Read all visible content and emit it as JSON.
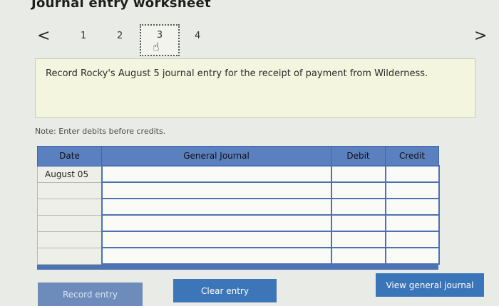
{
  "page": {
    "title": "Journal entry worksheet"
  },
  "nav": {
    "prev": "<",
    "next": ">",
    "tabs": [
      {
        "label": "1"
      },
      {
        "label": "2"
      },
      {
        "label": "3"
      },
      {
        "label": "4"
      }
    ]
  },
  "question": {
    "text": "Record Rocky's August 5 journal entry for the receipt of payment from Wilderness."
  },
  "note": {
    "text": "Note: Enter debits before credits."
  },
  "journal": {
    "headers": {
      "date": "Date",
      "account": "General Journal",
      "debit": "Debit",
      "credit": "Credit"
    },
    "rows": [
      {
        "date": "August 05",
        "account": "",
        "debit": "",
        "credit": ""
      },
      {
        "date": "",
        "account": "",
        "debit": "",
        "credit": ""
      },
      {
        "date": "",
        "account": "",
        "debit": "",
        "credit": ""
      },
      {
        "date": "",
        "account": "",
        "debit": "",
        "credit": ""
      },
      {
        "date": "",
        "account": "",
        "debit": "",
        "credit": ""
      },
      {
        "date": "",
        "account": "",
        "debit": "",
        "credit": ""
      }
    ]
  },
  "buttons": {
    "record": "Record entry",
    "clear": "Clear entry",
    "view": "View general journal"
  },
  "colors": {
    "header_blue": "#5a80c0",
    "button_blue": "#3a74b9",
    "question_bg": "#f4f5df"
  }
}
